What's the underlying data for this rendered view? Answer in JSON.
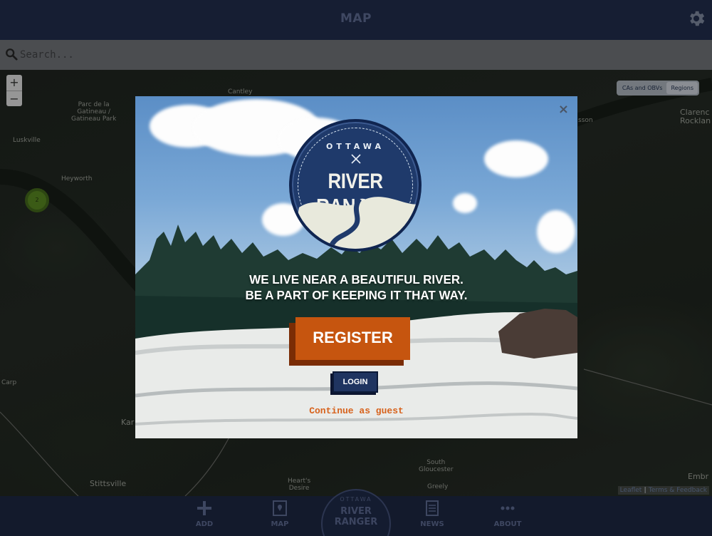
{
  "header": {
    "title": "MAP"
  },
  "search": {
    "placeholder": "Search..."
  },
  "map": {
    "zoom_in": "+",
    "zoom_out": "−",
    "layer_tabs": [
      "CAs and OBVs",
      "Regions"
    ],
    "cluster_count": "2",
    "labels": {
      "cantley": "Cantley",
      "parc": "Parc de la\nGatineau /\nGatineau Park",
      "luskville": "Luskville",
      "heyworth": "Heyworth",
      "clarence": "Clarenc\nRocklan",
      "carp": "Carp",
      "kar": "Kar",
      "stittsville": "Stittsville",
      "hearts_desire": "Heart's\nDesire",
      "south_gloucester": "South\nGloucester",
      "greely": "Greely",
      "embr": "Embr",
      "sson": "sson"
    },
    "attribution_link1": "Leaflet",
    "attribution_sep": " | ",
    "attribution_link2": "Terms & Feedback"
  },
  "modal": {
    "close": "×",
    "badge_top": "OTTAWA",
    "badge_title": "RIVER RANGER",
    "tagline_line1": "WE LIVE NEAR A BEAUTIFUL RIVER.",
    "tagline_line2": "BE A PART OF KEEPING IT THAT WAY.",
    "register": "REGISTER",
    "login": "LOGIN",
    "guest": "Continue as guest"
  },
  "nav": {
    "add": "ADD",
    "map": "MAP",
    "logo_top": "OTTAWA",
    "logo_title": "RIVER RANGER",
    "news": "NEWS",
    "about": "ABOUT"
  },
  "colors": {
    "accent": "#c6550f",
    "navy": "#1f3460",
    "guest_link": "#d7621c"
  }
}
